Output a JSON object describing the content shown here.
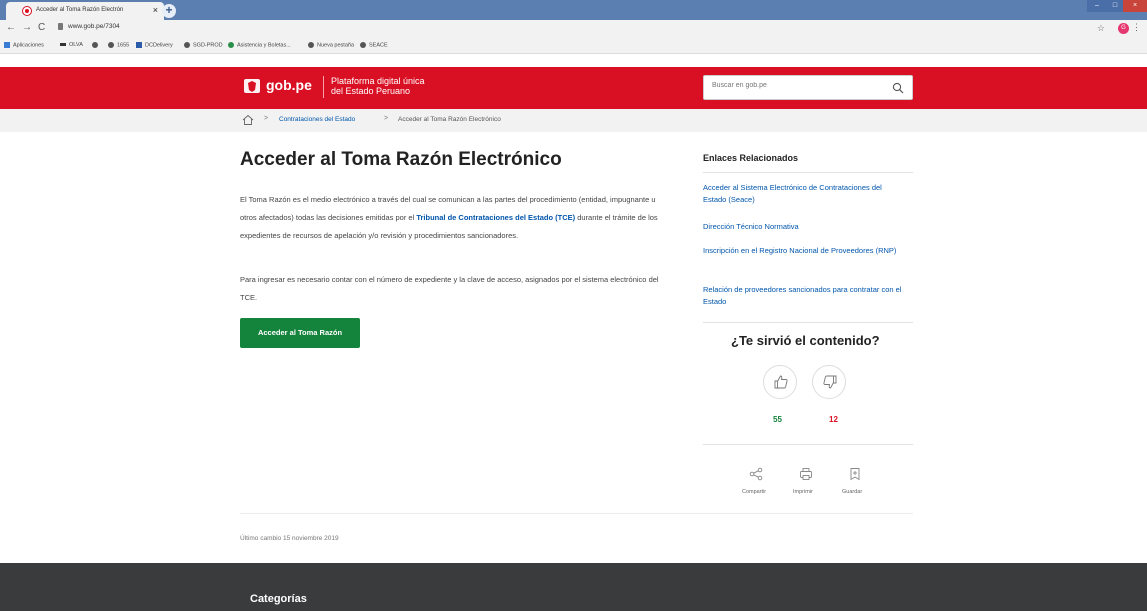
{
  "browser": {
    "tab_title": "Acceder al Toma Razón Electrón",
    "url": "www.gob.pe/7304",
    "bookmarks": [
      "Aplicaciones",
      "OLVA",
      "1655",
      "DCDelivery",
      "SGD-PROD",
      "Asistencia y Boletas...",
      "Nueva pestaña",
      "SEACE"
    ]
  },
  "header": {
    "logo": "gob.pe",
    "platform_line1": "Plataforma digital única",
    "platform_line2": "del Estado Peruano",
    "search_placeholder": "Buscar en gob.pe"
  },
  "breadcrumb": {
    "items": [
      "Contrataciones del Estado",
      "Acceder al Toma Razón Electrónico"
    ]
  },
  "main": {
    "title": "Acceder al Toma Razón Electrónico",
    "p1_before": "El Toma Razón es el medio electrónico a través del cual se comunican a las partes del procedimiento (entidad, impugnante u otros afectados) todas las decisiones emitidas por el ",
    "p1_link": "Tribunal de Contrataciones del Estado (TCE)",
    "p1_after": " durante el trámite de los expedientes de recursos de apelación y/o revisión y procedimientos sancionadores.",
    "p2": "Para ingresar es necesario contar con el número de expediente y la clave de acceso, asignados por el sistema electrónico del TCE.",
    "cta": "Acceder al Toma Razón"
  },
  "sidebar": {
    "title": "Enlaces Relacionados",
    "links": [
      "Acceder al Sistema Electrónico de Contrataciones del Estado (Seace)",
      "Dirección Técnico Normativa",
      "Inscripción en el Registro Nacional de Proveedores (RNP)",
      "Relación de proveedores sancionados para contratar con el Estado"
    ],
    "feedback_title": "¿Te sirvió el contenido?",
    "likes": "55",
    "dislikes": "12",
    "actions": [
      "Compartir",
      "Imprimir",
      "Guardar"
    ]
  },
  "updated": "Último cambio 15 noviembre 2019",
  "footer": {
    "title": "Categorías"
  },
  "colors": {
    "brand_red": "#d91023",
    "link_blue": "#0056ac",
    "cta_green": "#14833b",
    "like_green": "#14833b",
    "dislike_red": "#d91023"
  }
}
